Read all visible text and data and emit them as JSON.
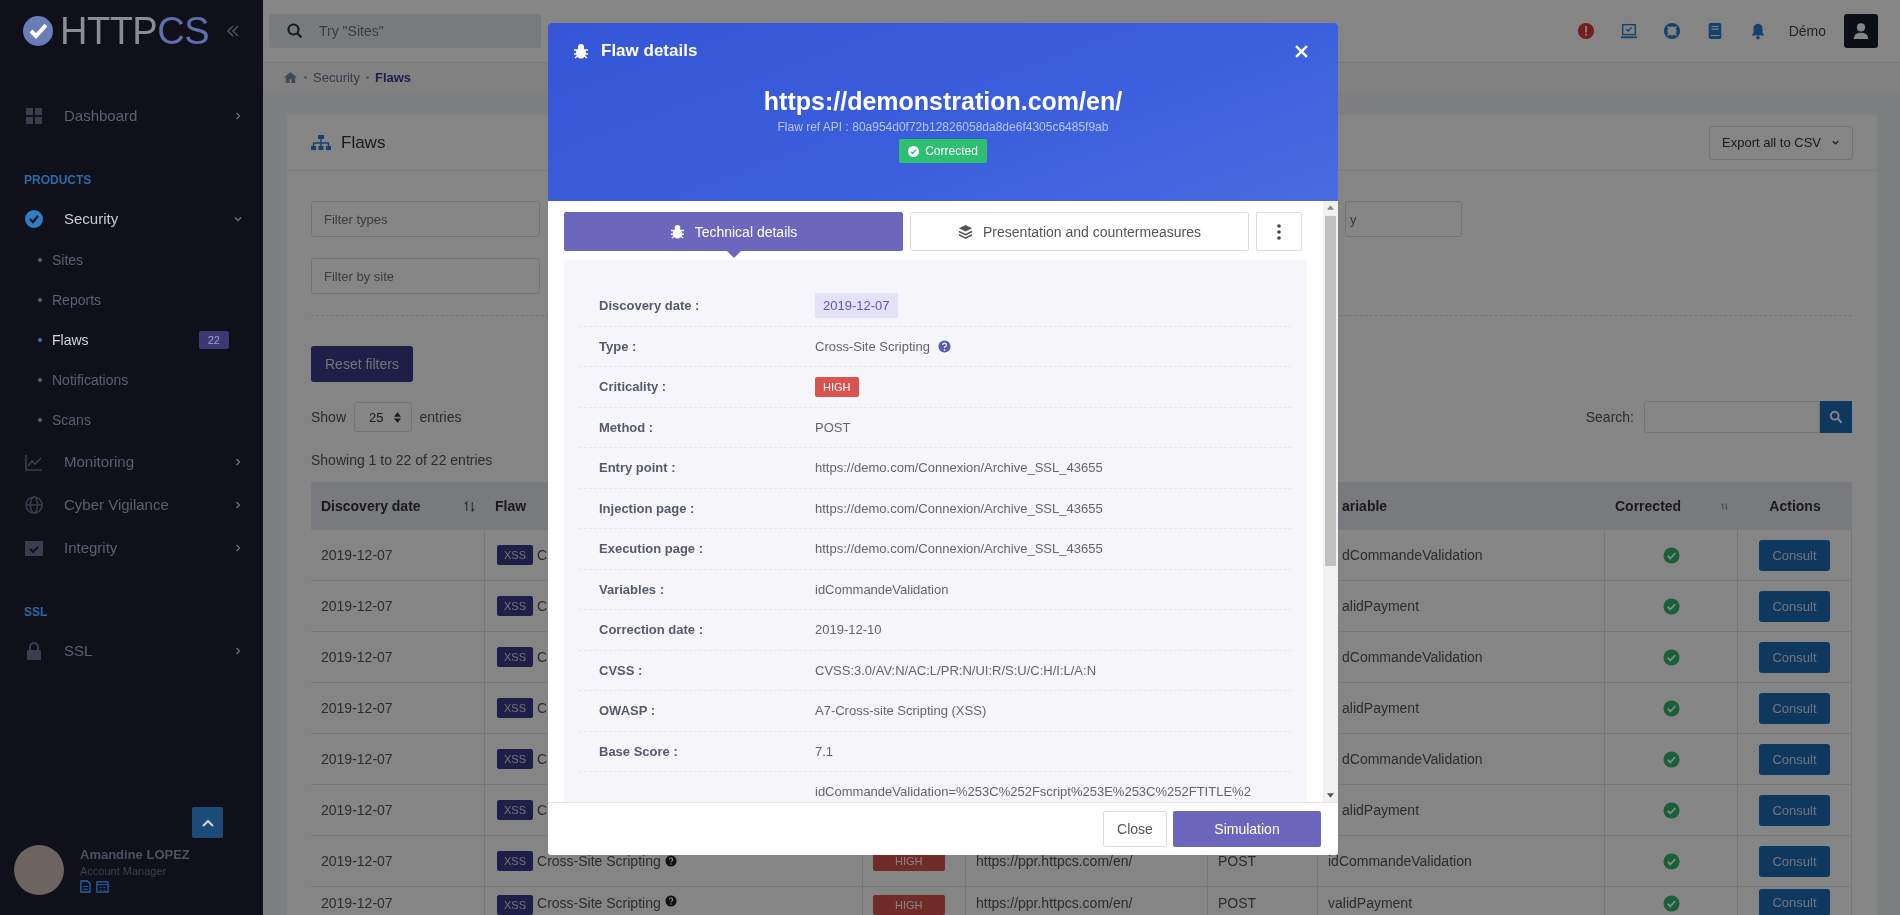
{
  "sidebar": {
    "logo": [
      "HTTP",
      "CS"
    ],
    "nav": [
      {
        "kind": "item",
        "label": "Dashboard",
        "expanded": false,
        "selected": false
      },
      {
        "kind": "section",
        "label": "PRODUCTS"
      },
      {
        "kind": "item",
        "label": "Security",
        "expanded": true,
        "selected": true,
        "children": [
          {
            "label": "Sites",
            "selected": false
          },
          {
            "label": "Reports",
            "selected": false
          },
          {
            "label": "Flaws",
            "selected": true,
            "badge": "22"
          },
          {
            "label": "Notifications",
            "selected": false
          },
          {
            "label": "Scans",
            "selected": false
          }
        ]
      },
      {
        "kind": "item",
        "label": "Monitoring",
        "expanded": false,
        "selected": false
      },
      {
        "kind": "item",
        "label": "Cyber Vigilance",
        "expanded": false,
        "selected": false
      },
      {
        "kind": "item",
        "label": "Integrity",
        "expanded": false,
        "selected": false
      },
      {
        "kind": "section",
        "label": "SSL"
      },
      {
        "kind": "item",
        "label": "SSL",
        "expanded": false,
        "selected": false
      }
    ],
    "profile": {
      "name": "Amandine LOPEZ",
      "role": "Account Manager"
    }
  },
  "topbar": {
    "search_placeholder": "Try \"Sites\"",
    "user": "Démo"
  },
  "breadcrumb": [
    "Security",
    "Flaws"
  ],
  "card": {
    "title": "Flaws",
    "export_button": "Export all to CSV",
    "filters": [
      {
        "placeholder": "Filter types"
      },
      {
        "placeholder": "y"
      },
      {
        "placeholder": "Filter by site"
      }
    ],
    "reset_button": "Reset filters",
    "length_before": "Show",
    "length_value": "25",
    "length_after": "entries",
    "search_label": "Search:",
    "info": "Showing 1 to 22 of 22 entries"
  },
  "table": {
    "columns": [
      {
        "label": "Discovery date",
        "sortable": true
      },
      {
        "label": "Flaw"
      },
      {
        "label": "ariable"
      },
      {
        "label": "Corrected",
        "sortable": true
      },
      {
        "label": "Actions"
      }
    ],
    "rows": [
      {
        "date": "2019-12-07",
        "tag": "XSS",
        "flaw": "C",
        "variable": "dCommandeValidation",
        "corrected": true,
        "action": "Consult"
      },
      {
        "date": "2019-12-07",
        "tag": "XSS",
        "flaw": "C",
        "variable": "alidPayment",
        "corrected": true,
        "action": "Consult"
      },
      {
        "date": "2019-12-07",
        "tag": "XSS",
        "flaw": "C",
        "variable": "dCommandeValidation",
        "corrected": true,
        "action": "Consult"
      },
      {
        "date": "2019-12-07",
        "tag": "XSS",
        "flaw": "C",
        "variable": "alidPayment",
        "corrected": true,
        "action": "Consult"
      },
      {
        "date": "2019-12-07",
        "tag": "XSS",
        "flaw": "C",
        "variable": "dCommandeValidation",
        "corrected": true,
        "action": "Consult"
      },
      {
        "date": "2019-12-07",
        "tag": "XSS",
        "flaw": "C",
        "variable": "alidPayment",
        "corrected": true,
        "action": "Consult"
      },
      {
        "date": "2019-12-07",
        "tag": "XSS",
        "flaw": "Cross-Site Scripting",
        "criticality": "HIGH",
        "url": "https://ppr.httpcs.com/en/",
        "method": "POST",
        "variable": "idCommandeValidation",
        "corrected": true,
        "action": "Consult"
      },
      {
        "date": "2019-12-07",
        "tag": "XSS",
        "flaw": "Cross-Site Scripting",
        "criticality": "HIGH",
        "url": "https://ppr.httpcs.com/en/",
        "method": "POST",
        "variable": "validPayment",
        "corrected": true,
        "action": "Consult"
      }
    ]
  },
  "modal": {
    "title": "Flaw details",
    "url": "https://demonstration.com/en/",
    "ref": "Flaw ref API : 80a954d0f72b12826058da8de6f4305c6485f9ab",
    "status": "Corrected",
    "tabs": [
      {
        "label": "Technical details",
        "selected": true
      },
      {
        "label": "Presentation and countermeasures",
        "selected": false
      }
    ],
    "details": [
      {
        "kind": "date",
        "label": "Discovery date :",
        "value": "2019-12-07"
      },
      {
        "kind": "help",
        "label": "Type :",
        "value": "Cross-Site Scripting"
      },
      {
        "kind": "badge",
        "label": "Criticality :",
        "value": "HIGH"
      },
      {
        "kind": "text",
        "label": "Method :",
        "value": "POST"
      },
      {
        "kind": "text",
        "label": "Entry point :",
        "value": "https://demo.com/Connexion/Archive_SSL_43655"
      },
      {
        "kind": "text",
        "label": "Injection page :",
        "value": "https://demo.com/Connexion/Archive_SSL_43655"
      },
      {
        "kind": "text",
        "label": "Execution page :",
        "value": "https://demo.com/Connexion/Archive_SSL_43655"
      },
      {
        "kind": "text",
        "label": "Variables :",
        "value": "idCommandeValidation"
      },
      {
        "kind": "text",
        "label": "Correction date :",
        "value": "2019-12-10"
      },
      {
        "kind": "text",
        "label": "CVSS :",
        "value": "CVSS:3.0/AV:N/AC:L/PR:N/UI:R/S:U/C:H/I:L/A:N"
      },
      {
        "kind": "text",
        "label": "OWASP :",
        "value": "A7-Cross-site Scripting (XSS)"
      },
      {
        "kind": "text",
        "label": "Base Score :",
        "value": "7.1"
      },
      {
        "kind": "text",
        "value": "idCommandeValidation=%253C%252Fscript%253E%253C%252FTITLE%2"
      }
    ],
    "buttons": [
      {
        "label": "Close",
        "kind": "secondary"
      },
      {
        "label": "Simulation",
        "kind": "primary"
      }
    ]
  }
}
